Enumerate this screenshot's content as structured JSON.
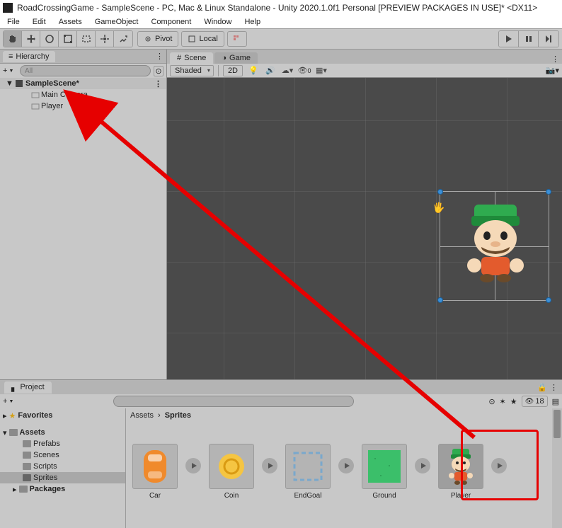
{
  "title": "RoadCrossingGame - SampleScene - PC, Mac & Linux Standalone - Unity 2020.1.0f1 Personal [PREVIEW PACKAGES IN USE]* <DX11>",
  "menu": {
    "file": "File",
    "edit": "Edit",
    "assets": "Assets",
    "gameobject": "GameObject",
    "component": "Component",
    "window": "Window",
    "help": "Help"
  },
  "toolbar": {
    "pivot": "Pivot",
    "local": "Local"
  },
  "hierarchy": {
    "tab": "Hierarchy",
    "search_placeholder": "All",
    "scene": "SampleScene*",
    "items": [
      "Main Camera",
      "Player"
    ]
  },
  "scene": {
    "tab_scene": "Scene",
    "tab_game": "Game",
    "shading": "Shaded",
    "mode2d": "2D",
    "visible_count": "0"
  },
  "project": {
    "tab": "Project",
    "hidden_count": "18",
    "breadcrumb": [
      "Assets",
      "Sprites"
    ],
    "tree": {
      "favorites": "Favorites",
      "assets": "Assets",
      "folders": [
        "Prefabs",
        "Scenes",
        "Scripts",
        "Sprites"
      ],
      "packages": "Packages"
    },
    "assets": [
      {
        "name": "Car"
      },
      {
        "name": "Coin"
      },
      {
        "name": "EndGoal"
      },
      {
        "name": "Ground"
      },
      {
        "name": "Player"
      }
    ]
  }
}
